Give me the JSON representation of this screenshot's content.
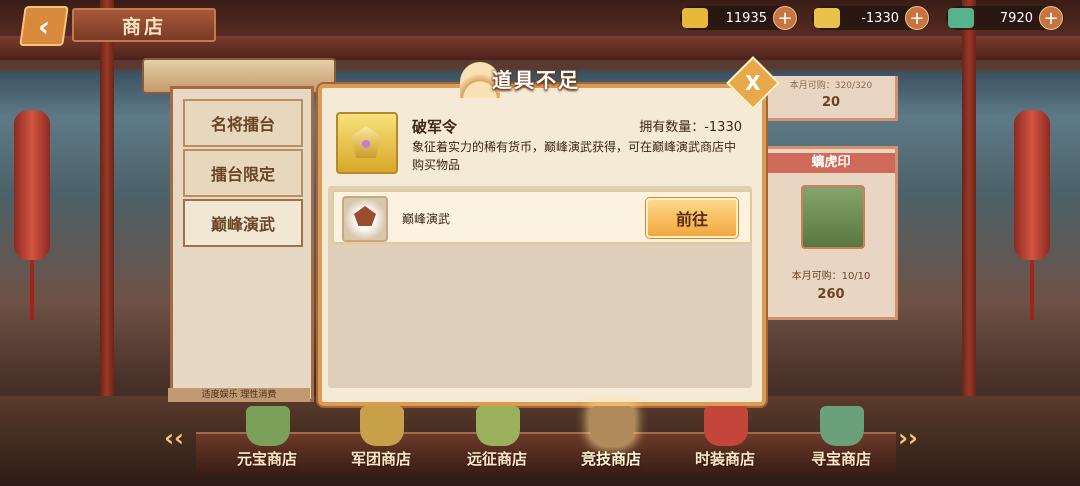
{
  "header": {
    "back_icon": "chevron-left-icon",
    "title": "商店"
  },
  "currencies": [
    {
      "icon": "gold-ingot-icon",
      "value": "11935",
      "color": "#e6b93a"
    },
    {
      "icon": "token-icon",
      "value": "-1330",
      "color": "#e8c24b"
    },
    {
      "icon": "jade-icon",
      "value": "7920",
      "color": "#56b38a"
    }
  ],
  "tabs": [
    {
      "label": "名将擂台",
      "active": false
    },
    {
      "label": "擂台限定",
      "active": false
    },
    {
      "label": "巅峰演武",
      "active": true
    }
  ],
  "notice": "适度娱乐 理性消费",
  "shop_behind": {
    "top_limit": "本月可购：320/320",
    "top_price": "20",
    "card_label": "螭虎印",
    "card_limit": "本月可购：10/10",
    "card_price": "260"
  },
  "modal": {
    "title": "道具不足",
    "close_label": "X",
    "item_name": "破军令",
    "owned": "拥有数量：-1330",
    "description": "象征着实力的稀有货币，巅峰演武获得，可在巅峰演武商店中购买物品",
    "sources": [
      {
        "name": "巅峰演武",
        "button": "前往"
      }
    ]
  },
  "bottom_nav": [
    {
      "label": "元宝商店",
      "icon": "jar-icon",
      "color": "#7aa05a",
      "active": false
    },
    {
      "label": "军团商店",
      "icon": "cauldron-icon",
      "color": "#c9a04a",
      "active": false
    },
    {
      "label": "远征商店",
      "icon": "flag-pot-icon",
      "color": "#9ab05a",
      "active": false
    },
    {
      "label": "竞技商店",
      "icon": "chair-icon",
      "color": "#b08a5a",
      "active": true
    },
    {
      "label": "时装商店",
      "icon": "gift-box-icon",
      "color": "#c4463b",
      "active": false
    },
    {
      "label": "寻宝商店",
      "icon": "teapot-icon",
      "color": "#6aa07a",
      "active": false
    }
  ]
}
